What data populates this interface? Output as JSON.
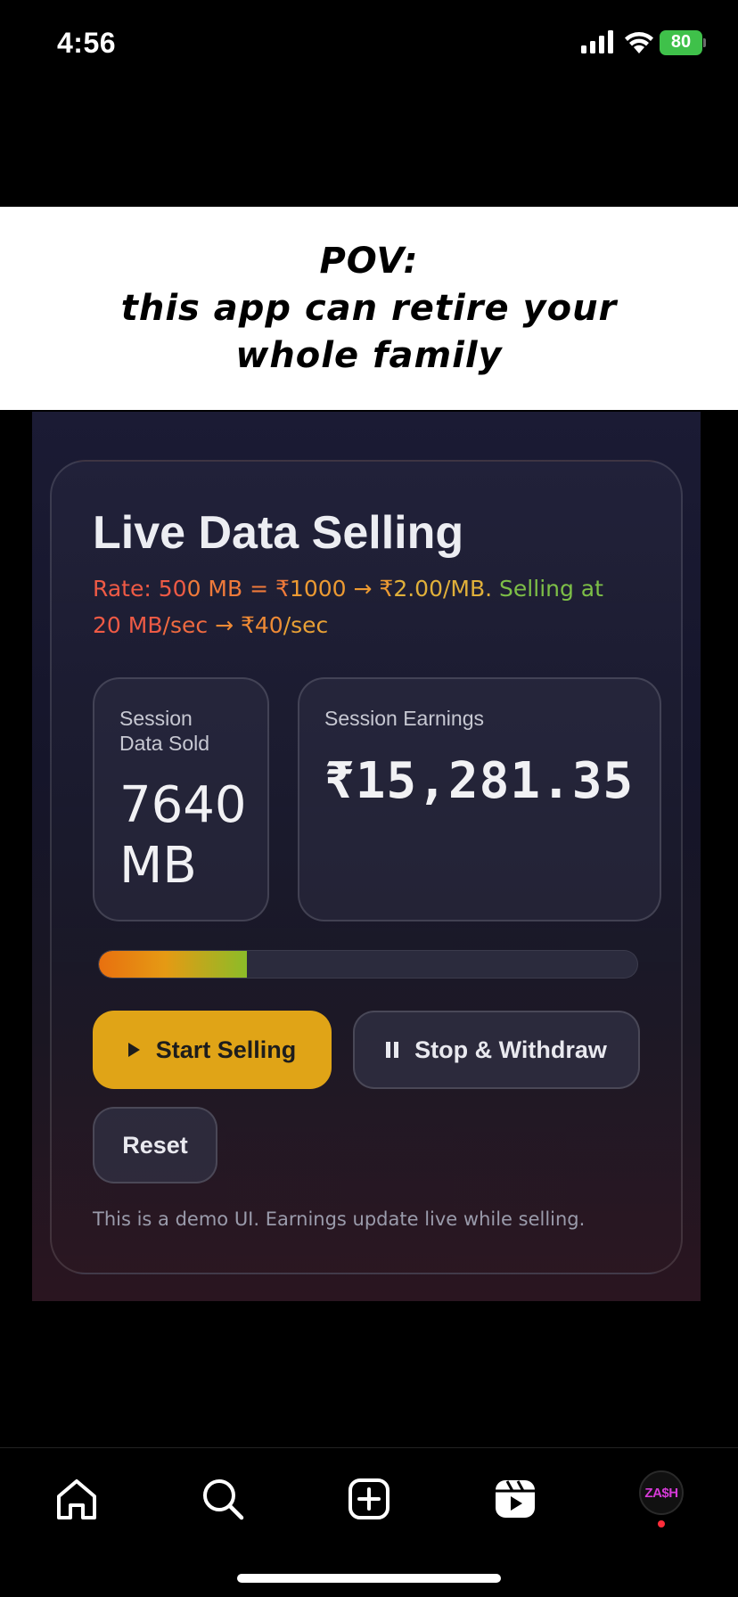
{
  "status_bar": {
    "time": "4:56",
    "battery_level": "80"
  },
  "caption": {
    "line1": "POV:",
    "line2": "this app can retire your",
    "line3": "whole family"
  },
  "app": {
    "title": "Live Data Selling",
    "rate": {
      "line1_part1": "Rate: 500 MB = ₹1000 → ₹2.00/MB.",
      "line1_part2": " Selling at",
      "line2": "20 MB/sec → ₹40/sec"
    },
    "data_sold": {
      "label_line1": "Session",
      "label_line2": "Data Sold",
      "value_line1": "7640",
      "value_line2": "MB"
    },
    "earnings": {
      "label": "Session Earnings",
      "value": "₹15,281.35"
    },
    "progress_fraction": 0.275,
    "buttons": {
      "start": "Start Selling",
      "stop": "Stop & Withdraw",
      "reset": "Reset"
    },
    "footnote": "This is a demo UI. Earnings update live while selling.",
    "colors": {
      "accent_button": "#e0a417",
      "rate_red": "#ee5a45",
      "rate_green": "#7dbf47"
    }
  },
  "tab_bar": {
    "items": [
      {
        "icon": "home-icon"
      },
      {
        "icon": "search-icon"
      },
      {
        "icon": "create-icon"
      },
      {
        "icon": "reels-icon"
      },
      {
        "icon": "profile-avatar"
      }
    ],
    "avatar_text": "ZA$H"
  }
}
